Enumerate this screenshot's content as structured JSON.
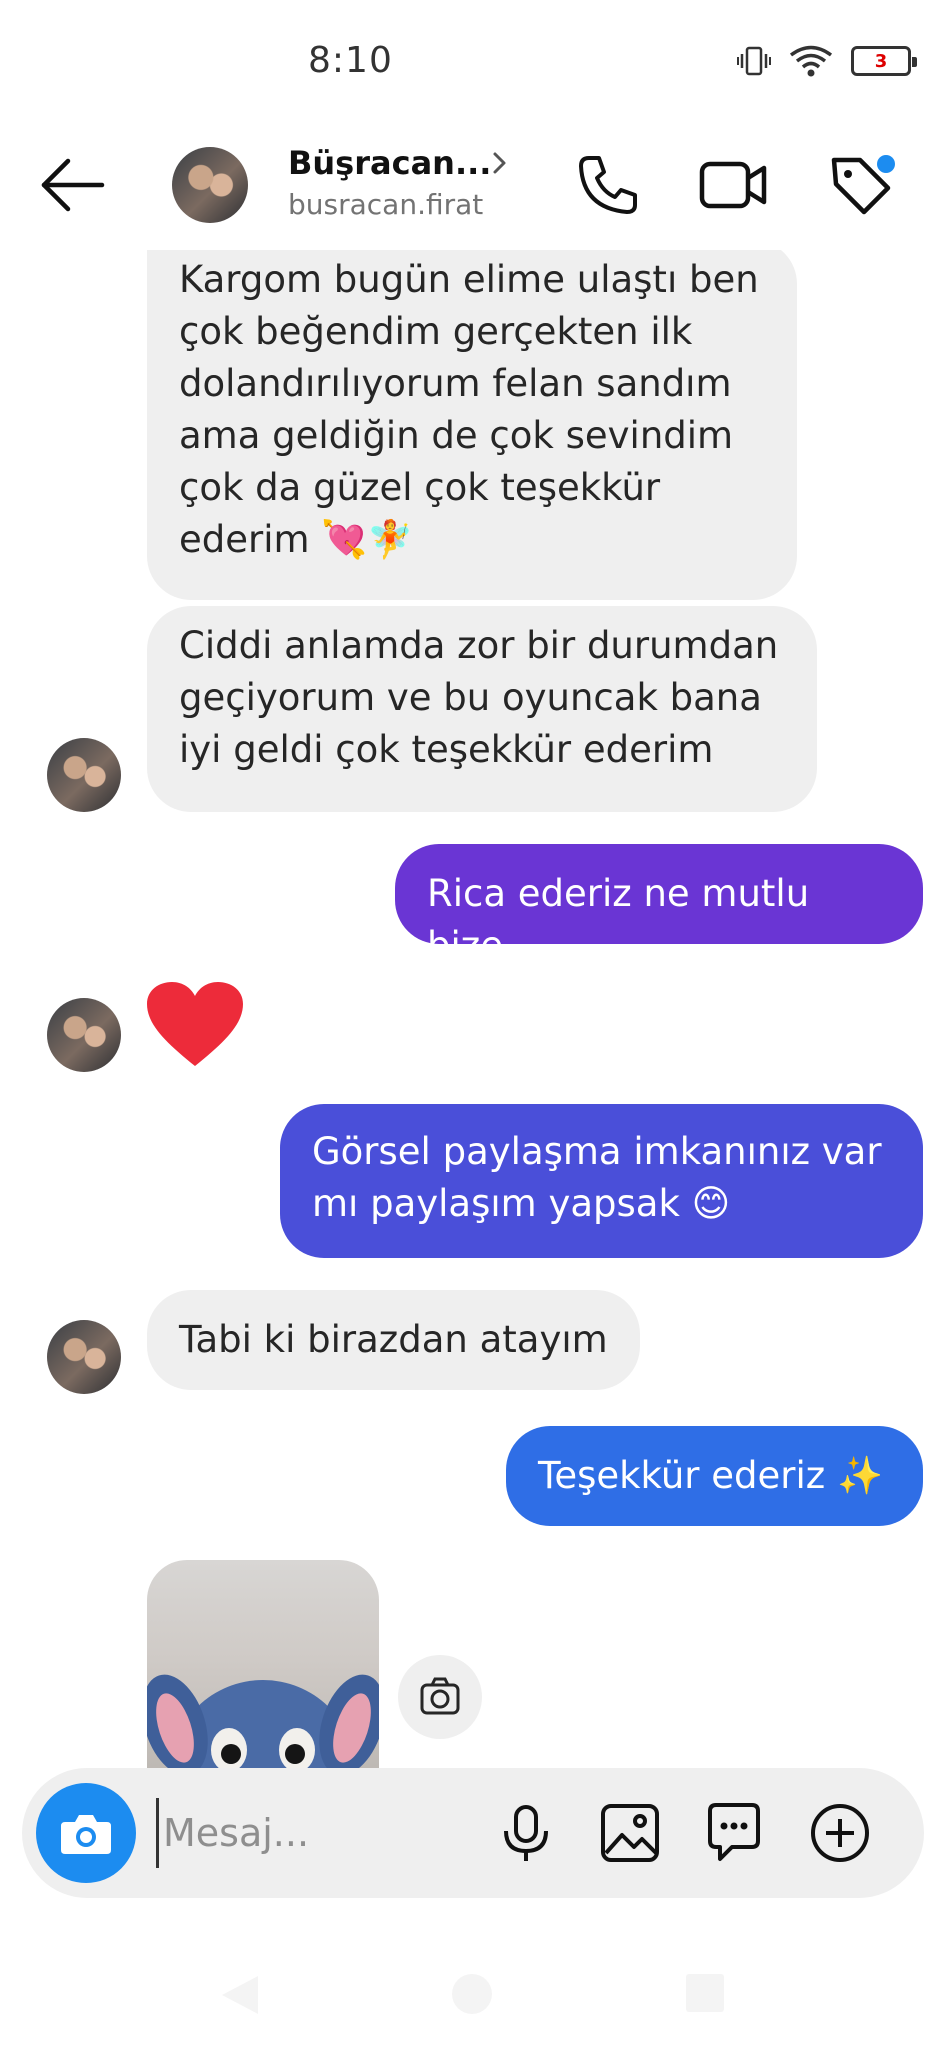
{
  "status_bar": {
    "time": "8:10",
    "battery": "3"
  },
  "header": {
    "contact_name": "Büşracan...",
    "username": "busracan.firat"
  },
  "messages": [
    {
      "direction": "incoming",
      "text": "Kargom bugün elime ulaştı ben\nçok beğendim gerçekten ilk\ndolandırılıyorum felan sandım\nama geldiğin de çok sevindim\nçok da güzel çok teşekkür\nederim 💘🧚"
    },
    {
      "direction": "incoming",
      "text": "Ciddi anlamda zor bir durumdan\ngeçiyorum ve bu oyuncak bana\niyi geldi çok teşekkür ederim"
    },
    {
      "direction": "outgoing",
      "text": "Rica ederiz ne mutlu bize"
    },
    {
      "direction": "incoming",
      "type": "reaction",
      "icon": "heart-icon"
    },
    {
      "direction": "outgoing",
      "text": "Görsel paylaşma imkanınız var\nmı paylaşım yapsak 😊"
    },
    {
      "direction": "incoming",
      "text": "Tabi ki birazdan atayım"
    },
    {
      "direction": "outgoing",
      "text": "Teşekkür ederiz ✨"
    },
    {
      "direction": "incoming",
      "type": "photo",
      "icon": "photo-thumbnail"
    }
  ],
  "composer": {
    "placeholder": "Mesaj..."
  },
  "colors": {
    "outgoing_1": "#6a35d4",
    "outgoing_2": "#4a4fd9",
    "outgoing_3": "#2f6ee6",
    "incoming": "#efefef",
    "camera": "#1c8cf0",
    "notification_dot": "#1c8cf0",
    "heart": "#ed2b3a"
  }
}
